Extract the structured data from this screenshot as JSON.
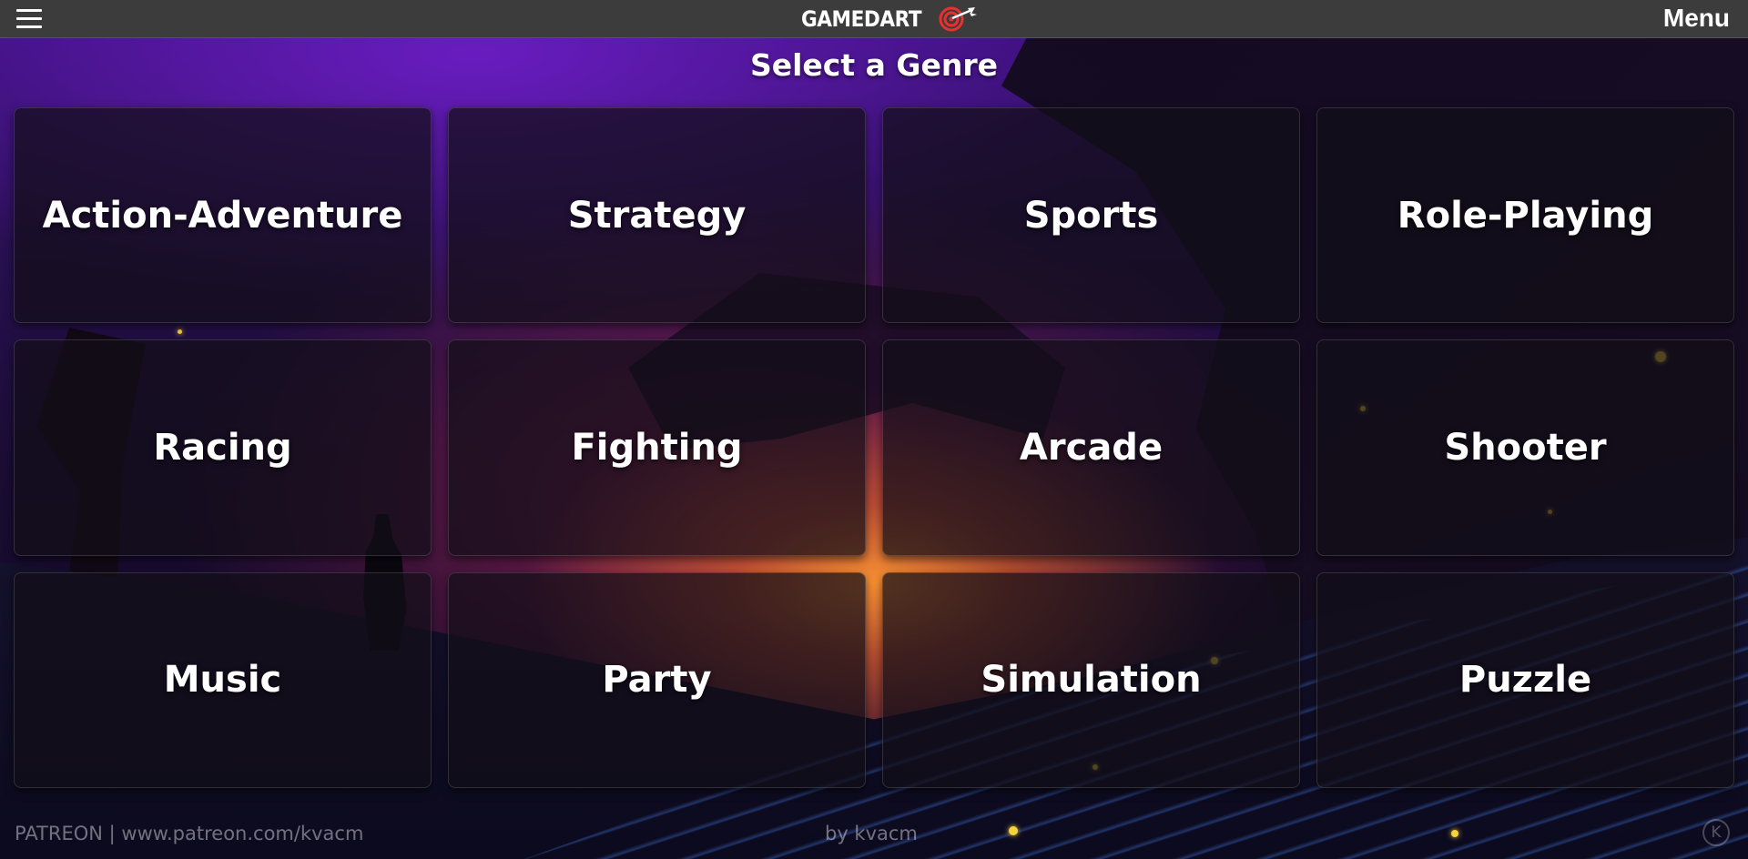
{
  "header": {
    "brand": "GAMEDART",
    "menu_label": "Menu",
    "icons": [
      "hamburger-menu-icon",
      "dart-target-icon"
    ]
  },
  "heading": "Select a Genre",
  "genres": [
    "Action-Adventure",
    "Strategy",
    "Sports",
    "Role-Playing",
    "Racing",
    "Fighting",
    "Arcade",
    "Shooter",
    "Music",
    "Party",
    "Simulation",
    "Puzzle"
  ],
  "footer": {
    "left_text": "PATREON | www.patreon.com/kvacm",
    "center_text": "by kvacm",
    "mark": "K"
  },
  "colors": {
    "topbar": "#3c3c3c",
    "accent": "#e8312f",
    "card_bg": "rgba(18,14,24,0.72)",
    "text": "#ffffff"
  }
}
